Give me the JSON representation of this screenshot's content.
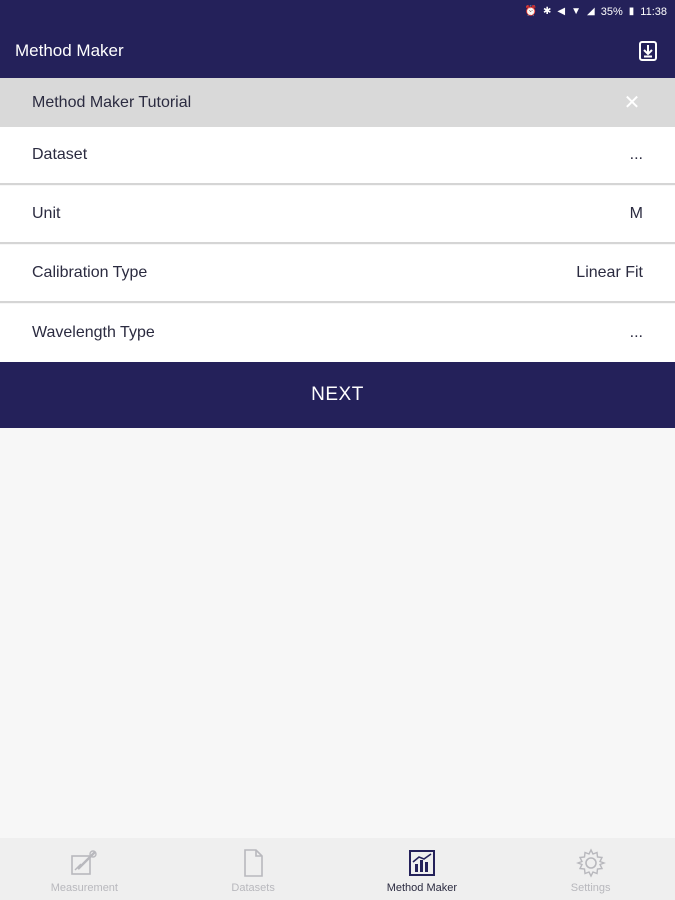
{
  "status_bar": {
    "battery_text": "35%",
    "time": "11:38",
    "icons": [
      "alarm-icon",
      "bluetooth-icon",
      "mute-icon",
      "wifi-icon",
      "signal-icon",
      "battery-icon"
    ]
  },
  "app_bar": {
    "title": "Method Maker",
    "action_icon": "save-download-icon"
  },
  "tutorial_banner": {
    "label": "Method Maker Tutorial",
    "close_glyph": "✕"
  },
  "form": {
    "rows": [
      {
        "label": "Dataset",
        "value": "..."
      },
      {
        "label": "Unit",
        "value": "M"
      },
      {
        "label": "Calibration Type",
        "value": "Linear Fit"
      },
      {
        "label": "Wavelength Type",
        "value": "..."
      }
    ]
  },
  "next_button": {
    "label": "NEXT"
  },
  "bottom_nav": {
    "items": [
      {
        "label": "Measurement",
        "icon": "measurement-icon",
        "active": false
      },
      {
        "label": "Datasets",
        "icon": "document-icon",
        "active": false
      },
      {
        "label": "Method Maker",
        "icon": "chart-icon",
        "active": true
      },
      {
        "label": "Settings",
        "icon": "gear-icon",
        "active": false
      }
    ]
  },
  "colors": {
    "primary": "#24215a",
    "banner": "#d9d9d9",
    "background": "#f7f7f7",
    "inactive_nav": "#b8b8bd"
  }
}
